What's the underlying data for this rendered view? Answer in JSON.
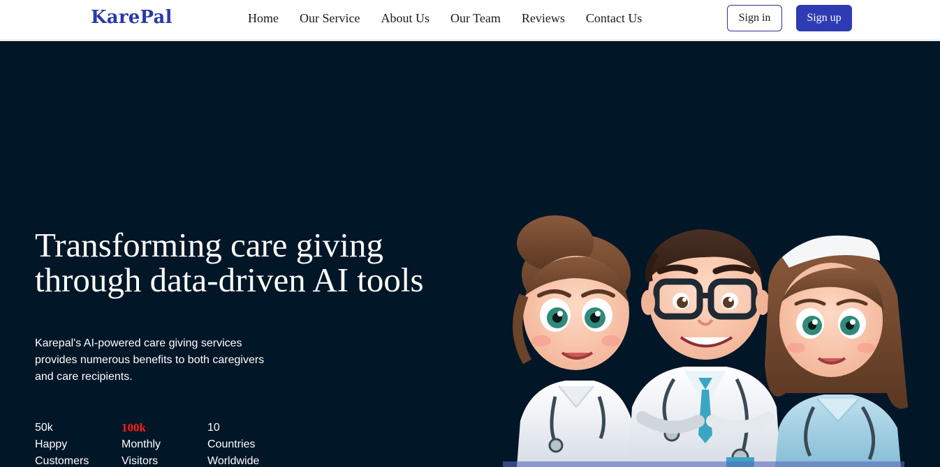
{
  "brand": {
    "name": "KarePal",
    "color": "#2b3aa8"
  },
  "nav": {
    "items": [
      {
        "label": "Home"
      },
      {
        "label": "Our Service"
      },
      {
        "label": "About Us"
      },
      {
        "label": "Our Team"
      },
      {
        "label": "Reviews"
      },
      {
        "label": "Contact Us"
      }
    ]
  },
  "auth": {
    "signin_label": "Sign in",
    "signup_label": "Sign up",
    "accent": "#2e3bb3"
  },
  "hero": {
    "headline_line1": "Transforming care giving",
    "headline_line2": "through data-driven AI tools",
    "description": "Karepal's AI-powered care giving services provides numerous benefits to both caregivers and care recipients.",
    "background": "#011627",
    "illustration": "three cartoon healthcare workers (female doctor, male doctor with glasses, nurse)"
  },
  "stats": [
    {
      "value": "50k",
      "line1": "Happy",
      "line2": "Customers"
    },
    {
      "value": "100k",
      "line1": "Monthly",
      "line2": "Visitors",
      "highlight": "#ff1a1a"
    },
    {
      "value": "10",
      "line1": "Countries",
      "line2": "Worldwide"
    }
  ]
}
